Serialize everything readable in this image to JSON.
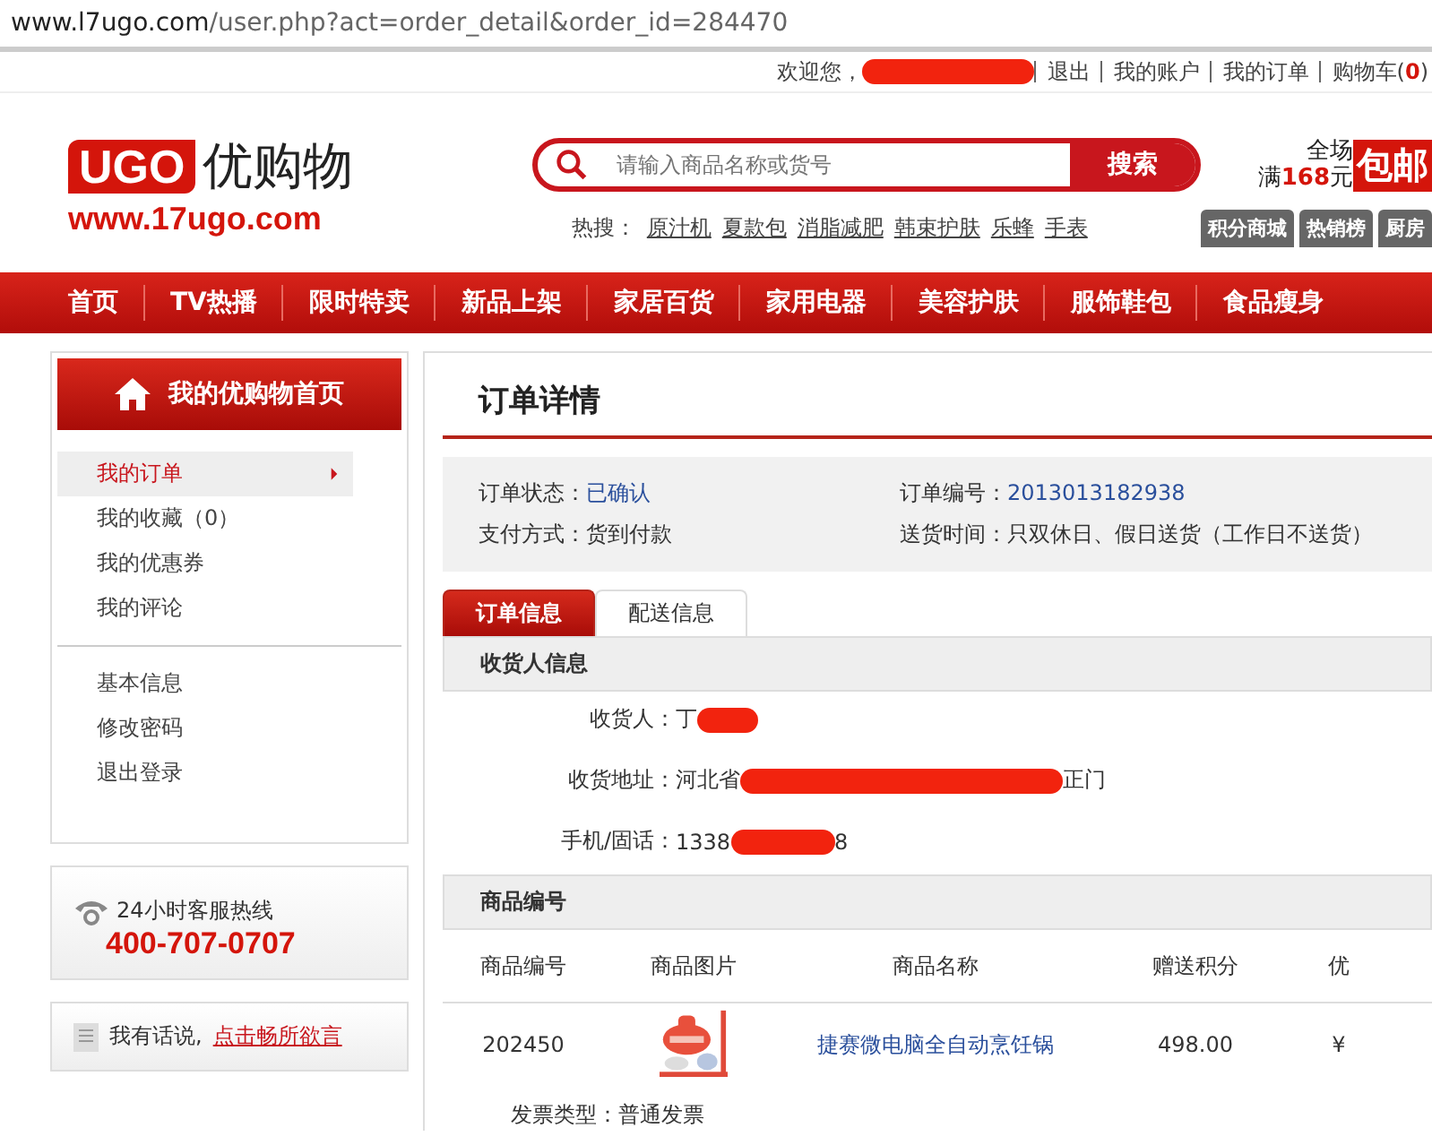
{
  "address_bar": {
    "host": "www.l7ugo.com",
    "path": "/user.php?act=order_detail&order_id=284470"
  },
  "top_bar": {
    "welcome": "欢迎您，",
    "welcome_redacted": true,
    "links": [
      "退出",
      "我的账户",
      "我的订单"
    ],
    "cart_label": "购物车(",
    "cart_count": "0",
    "cart_close": ")"
  },
  "logo": {
    "badge": "UGO",
    "name": "优购物",
    "url": "www.17ugo.com"
  },
  "search": {
    "placeholder": "请输入商品名称或货号",
    "button": "搜索"
  },
  "hot_search": {
    "label": "热搜：",
    "keywords": [
      "原汁机",
      "夏款包",
      "消脂减肥",
      "韩束护肤",
      "乐蜂",
      "手表"
    ]
  },
  "promo": {
    "line1": "全场",
    "prefix": "满",
    "amount": "168",
    "unit": "元",
    "badge": "包邮"
  },
  "header_tabs": [
    "积分商城",
    "热销榜",
    "厨房"
  ],
  "nav": [
    "首页",
    "TV热播",
    "限时特卖",
    "新品上架",
    "家居百货",
    "家用电器",
    "美容护肤",
    "服饰鞋包",
    "食品瘦身"
  ],
  "sidebar": {
    "title": "我的优购物首页",
    "groups": [
      [
        {
          "label": "我的订单",
          "selected": true
        },
        {
          "label": "我的收藏（0）",
          "selected": false
        },
        {
          "label": "我的优惠券",
          "selected": false
        },
        {
          "label": "我的评论",
          "selected": false
        }
      ],
      [
        {
          "label": "基本信息",
          "selected": false
        },
        {
          "label": "修改密码",
          "selected": false
        },
        {
          "label": "退出登录",
          "selected": false
        }
      ]
    ]
  },
  "hotline": {
    "label": "24小时客服热线",
    "number": "400-707-0707"
  },
  "feedback": {
    "text": "我有话说,",
    "link": "点击畅所欲言"
  },
  "order": {
    "title": "订单详情",
    "summary": [
      {
        "label": "订单状态：",
        "value": "已确认",
        "kind": "link"
      },
      {
        "label": "订单编号：",
        "value": "2013013182938",
        "kind": "link"
      },
      {
        "label": "支付方式：",
        "value": "货到付款",
        "kind": "plain"
      },
      {
        "label": "送货时间：",
        "value": "只双休日、假日送货（工作日不送货）",
        "kind": "plain"
      }
    ],
    "tabs": [
      {
        "label": "订单信息",
        "selected": true
      },
      {
        "label": "配送信息",
        "selected": false
      }
    ],
    "receiver_heading": "收货人信息",
    "receiver": [
      {
        "label": "收货人：",
        "value": "丁",
        "redacted": true
      },
      {
        "label": "收货地址：",
        "value": "河北省",
        "redacted": true,
        "suffix": "正门"
      },
      {
        "label": "手机/固话：",
        "value": "1338",
        "redacted": true,
        "suffix": "8"
      }
    ],
    "goods_heading": "商品编号",
    "table": {
      "columns": [
        "商品编号",
        "商品图片",
        "商品名称",
        "赠送积分",
        "优"
      ],
      "rows": [
        {
          "code": "202450",
          "name": "捷赛微电脑全自动烹饪锅",
          "points": "498.00",
          "column_5": "¥"
        }
      ]
    },
    "invoice": {
      "label": "发票类型：",
      "value": "普通发票"
    }
  }
}
